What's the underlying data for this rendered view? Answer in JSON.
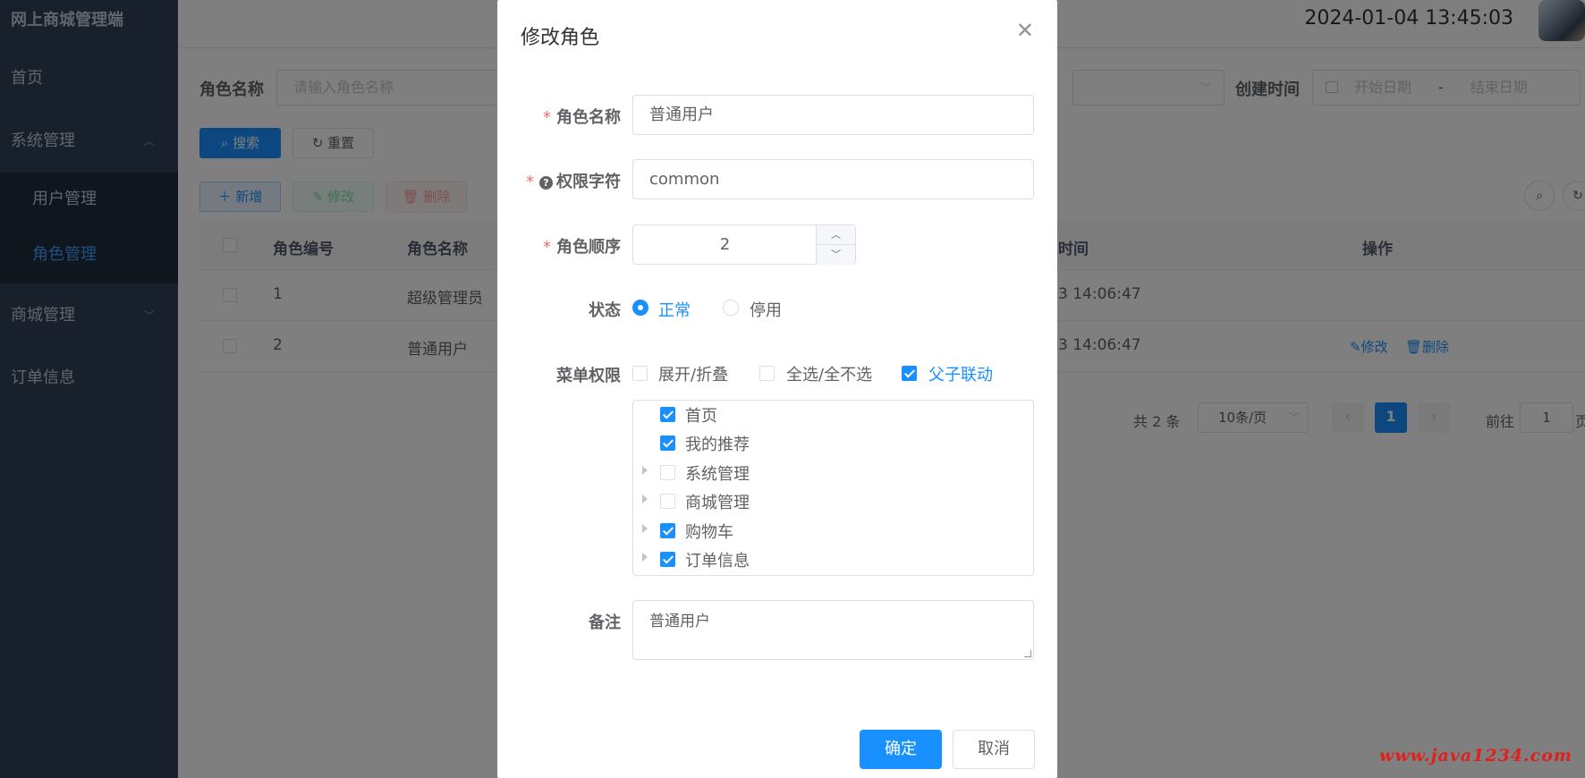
{
  "sidebar": {
    "title": "网上商城管理端",
    "items": [
      {
        "label": "首页"
      },
      {
        "label": "系统管理",
        "chevron": "chevron-up-icon"
      },
      {
        "label": "用户管理"
      },
      {
        "label": "角色管理"
      },
      {
        "label": "商城管理",
        "chevron": "chevron-down-icon"
      },
      {
        "label": "订单信息"
      }
    ]
  },
  "header": {
    "datetime": "2024-01-04 13:45:03"
  },
  "search": {
    "role_name_label": "角色名称",
    "role_name_placeholder": "请输入角色名称",
    "create_time_label": "创建时间",
    "start_placeholder": "开始日期",
    "range_sep": "-",
    "end_placeholder": "结束日期",
    "search_button": "搜索",
    "reset_button": "重置"
  },
  "toolbar": {
    "add": "新增",
    "edit": "修改",
    "delete": "删除"
  },
  "table": {
    "columns": [
      "角色编号",
      "角色名称",
      "时间",
      "操作"
    ],
    "rows": [
      {
        "id": "1",
        "name": "超级管理员",
        "time": "3 14:06:47"
      },
      {
        "id": "2",
        "name": "普通用户",
        "time": "3 14:06:47",
        "edit": "修改",
        "delete": "删除"
      }
    ]
  },
  "pagination": {
    "total": "共 2 条",
    "page_size": "10条/页",
    "current": "1",
    "goto_label": "前往",
    "goto_value": "1",
    "goto_suffix": "页"
  },
  "dialog": {
    "title": "修改角色",
    "fields": {
      "role_name_label": "角色名称",
      "role_name_value": "普通用户",
      "permission_label": "权限字符",
      "permission_value": "common",
      "order_label": "角色顺序",
      "order_value": "2",
      "status_label": "状态",
      "status_options": [
        "正常",
        "停用"
      ],
      "status_selected": "正常",
      "menu_label": "菜单权限",
      "menu_options": [
        {
          "label": "展开/折叠",
          "checked": false
        },
        {
          "label": "全选/全不选",
          "checked": false
        },
        {
          "label": "父子联动",
          "checked": true
        }
      ],
      "menu_tree": [
        {
          "label": "首页",
          "checked": true,
          "expandable": false
        },
        {
          "label": "我的推荐",
          "checked": true,
          "expandable": false
        },
        {
          "label": "系统管理",
          "checked": false,
          "expandable": true
        },
        {
          "label": "商城管理",
          "checked": false,
          "expandable": true
        },
        {
          "label": "购物车",
          "checked": true,
          "expandable": true
        },
        {
          "label": "订单信息",
          "checked": true,
          "expandable": true
        }
      ],
      "remark_label": "备注",
      "remark_value": "普通用户"
    },
    "confirm_button": "确定",
    "cancel_button": "取消"
  },
  "watermark": "www.java1234.com",
  "colors": {
    "sidebar_bg": "#304156",
    "primary": "#1890ff",
    "required": "#f56c6c",
    "watermark": "#e0201a"
  }
}
